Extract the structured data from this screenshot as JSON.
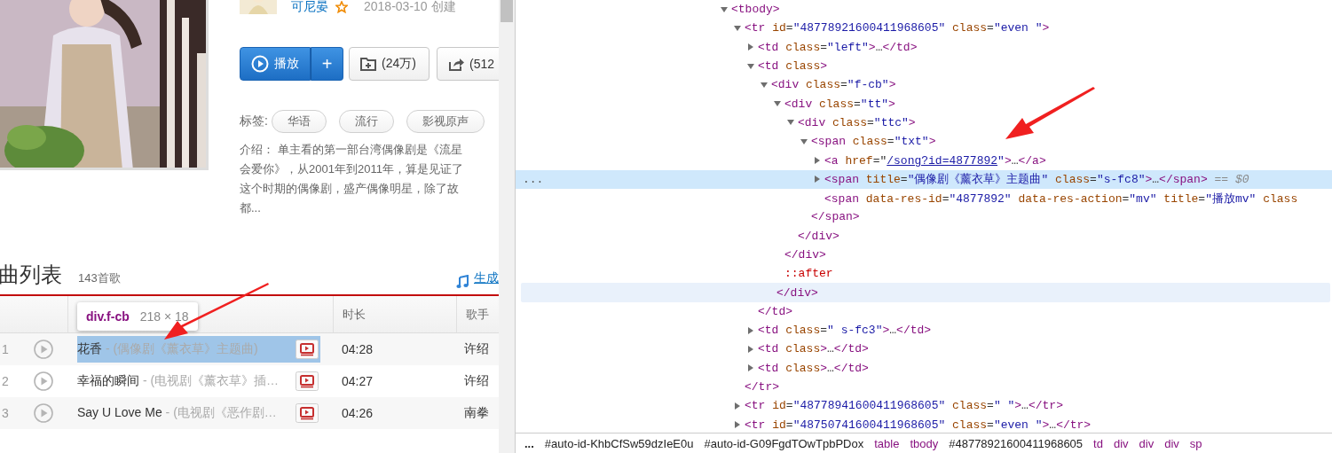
{
  "playlist": {
    "creator": "可尼晏",
    "created": "2018-03-10 创建",
    "buttons": [
      {
        "kind": "play",
        "label": "播放"
      },
      {
        "kind": "add",
        "label": "+"
      },
      {
        "kind": "collect",
        "label": "(24万)"
      },
      {
        "kind": "share",
        "label": "(512"
      }
    ],
    "tags_label": "标签:",
    "tags": [
      "华语",
      "流行",
      "影视原声"
    ],
    "intro_lines": [
      "介绍：  单主看的第一部台湾偶像剧是《流星",
      "会爱你》，从2001年到2011年，算是见证了",
      "这个时期的偶像剧，盛产偶像明星，除了故",
      "都..."
    ]
  },
  "song_list": {
    "title": "曲列表",
    "count": "143首歌",
    "link": "生成",
    "columns": [
      "时长",
      "歌手"
    ],
    "tooltip": {
      "selector": "div.f-cb",
      "size": "218 × 18"
    },
    "rows": [
      {
        "number": "1",
        "title": "花香",
        "subtitle": " - (偶像剧《薰衣草》主题曲)",
        "duration": "04:28",
        "singer": "许绍",
        "highlighted": true
      },
      {
        "number": "2",
        "title": "幸福的瞬间",
        "subtitle": " - (电视剧《薰衣草》插…",
        "duration": "04:27",
        "singer": "许绍",
        "highlighted": false
      },
      {
        "number": "3",
        "title": "Say U Love Me",
        "subtitle": " - (电视剧《恶作剧…",
        "duration": "04:26",
        "singer": "南拳",
        "highlighted": false
      }
    ]
  },
  "devtools": {
    "selection_marker": "...",
    "tree": [
      {
        "expanded": true,
        "selected": false,
        "hovered": false,
        "line": [
          {
            "kind": "tag",
            "text": "<tbody>"
          }
        ],
        "children": [
          {
            "expanded": true,
            "selected": false,
            "hovered": false,
            "line": [
              {
                "kind": "tag",
                "text": "<tr"
              },
              {
                "kind": "attr",
                "text": " id"
              },
              {
                "kind": "text",
                "text": "="
              },
              {
                "kind": "value",
                "text": "\"48778921600411968605\""
              },
              {
                "kind": "attr",
                "text": " class"
              },
              {
                "kind": "text",
                "text": "="
              },
              {
                "kind": "value",
                "text": "\"even \""
              },
              {
                "kind": "tag",
                "text": ">"
              }
            ],
            "close": [
              {
                "kind": "tag",
                "text": "</tr>"
              }
            ],
            "children": [
              {
                "expanded": false,
                "selected": false,
                "hovered": false,
                "line": [
                  {
                    "kind": "tag",
                    "text": "<td"
                  },
                  {
                    "kind": "attr",
                    "text": " class"
                  },
                  {
                    "kind": "text",
                    "text": "="
                  },
                  {
                    "kind": "value",
                    "text": "\"left\""
                  },
                  {
                    "kind": "tag",
                    "text": ">"
                  },
                  {
                    "kind": "text",
                    "text": "…"
                  },
                  {
                    "kind": "tag",
                    "text": "</td>"
                  }
                ]
              },
              {
                "expanded": true,
                "selected": false,
                "hovered": false,
                "line": [
                  {
                    "kind": "tag",
                    "text": "<td"
                  },
                  {
                    "kind": "attr",
                    "text": " class"
                  },
                  {
                    "kind": "tag",
                    "text": ">"
                  }
                ],
                "close": [
                  {
                    "kind": "tag",
                    "text": "</td>"
                  }
                ],
                "children": [
                  {
                    "expanded": true,
                    "selected": false,
                    "hovered": true,
                    "line": [
                      {
                        "kind": "tag",
                        "text": "<div"
                      },
                      {
                        "kind": "attr",
                        "text": " class"
                      },
                      {
                        "kind": "text",
                        "text": "="
                      },
                      {
                        "kind": "value",
                        "text": "\"f-cb\""
                      },
                      {
                        "kind": "tag",
                        "text": ">"
                      }
                    ],
                    "close": [
                      {
                        "kind": "tag",
                        "text": "</div>"
                      }
                    ],
                    "children": [
                      {
                        "expanded": true,
                        "selected": false,
                        "hovered": false,
                        "line": [
                          {
                            "kind": "tag",
                            "text": "<div"
                          },
                          {
                            "kind": "attr",
                            "text": " class"
                          },
                          {
                            "kind": "text",
                            "text": "="
                          },
                          {
                            "kind": "value",
                            "text": "\"tt\""
                          },
                          {
                            "kind": "tag",
                            "text": ">"
                          }
                        ],
                        "close": [
                          {
                            "kind": "tag",
                            "text": "</div>"
                          }
                        ],
                        "children": [
                          {
                            "expanded": true,
                            "selected": false,
                            "hovered": false,
                            "line": [
                              {
                                "kind": "tag",
                                "text": "<div"
                              },
                              {
                                "kind": "attr",
                                "text": " class"
                              },
                              {
                                "kind": "text",
                                "text": "="
                              },
                              {
                                "kind": "value",
                                "text": "\"ttc\""
                              },
                              {
                                "kind": "tag",
                                "text": ">"
                              }
                            ],
                            "close": [
                              {
                                "kind": "tag",
                                "text": "</div>"
                              }
                            ],
                            "children": [
                              {
                                "expanded": true,
                                "selected": false,
                                "hovered": false,
                                "line": [
                                  {
                                    "kind": "tag",
                                    "text": "<span"
                                  },
                                  {
                                    "kind": "attr",
                                    "text": " class"
                                  },
                                  {
                                    "kind": "text",
                                    "text": "="
                                  },
                                  {
                                    "kind": "value",
                                    "text": "\"txt\""
                                  },
                                  {
                                    "kind": "tag",
                                    "text": ">"
                                  }
                                ],
                                "close": [
                                  {
                                    "kind": "tag",
                                    "text": "</span>"
                                  }
                                ],
                                "children": [
                                  {
                                    "expanded": false,
                                    "selected": false,
                                    "hovered": false,
                                    "line": [
                                      {
                                        "kind": "tag",
                                        "text": "<a"
                                      },
                                      {
                                        "kind": "attr",
                                        "text": " href"
                                      },
                                      {
                                        "kind": "text",
                                        "text": "=\""
                                      },
                                      {
                                        "kind": "link",
                                        "text": "/song?id=4877892"
                                      },
                                      {
                                        "kind": "value",
                                        "text": "\""
                                      },
                                      {
                                        "kind": "tag",
                                        "text": ">"
                                      },
                                      {
                                        "kind": "text",
                                        "text": "…"
                                      },
                                      {
                                        "kind": "tag",
                                        "text": "</a>"
                                      }
                                    ]
                                  },
                                  {
                                    "expanded": false,
                                    "selected": true,
                                    "hovered": false,
                                    "line": [
                                      {
                                        "kind": "tag",
                                        "text": "<span"
                                      },
                                      {
                                        "kind": "attr",
                                        "text": " title"
                                      },
                                      {
                                        "kind": "text",
                                        "text": "="
                                      },
                                      {
                                        "kind": "value",
                                        "text": "\"偶像剧《薰衣草》主题曲\""
                                      },
                                      {
                                        "kind": "attr",
                                        "text": " class"
                                      },
                                      {
                                        "kind": "text",
                                        "text": "="
                                      },
                                      {
                                        "kind": "value",
                                        "text": "\"s-fc8\""
                                      },
                                      {
                                        "kind": "tag",
                                        "text": ">"
                                      },
                                      {
                                        "kind": "text",
                                        "text": "…"
                                      },
                                      {
                                        "kind": "tag",
                                        "text": "</span>"
                                      },
                                      {
                                        "kind": "note",
                                        "text": " == $0"
                                      }
                                    ]
                                  },
                                  {
                                    "selected": false,
                                    "hovered": false,
                                    "line": [
                                      {
                                        "kind": "tag",
                                        "text": "<span"
                                      },
                                      {
                                        "kind": "attr",
                                        "text": " data-res-id"
                                      },
                                      {
                                        "kind": "text",
                                        "text": "="
                                      },
                                      {
                                        "kind": "value",
                                        "text": "\"4877892\""
                                      },
                                      {
                                        "kind": "attr",
                                        "text": " data-res-action"
                                      },
                                      {
                                        "kind": "text",
                                        "text": "="
                                      },
                                      {
                                        "kind": "value",
                                        "text": "\"mv\""
                                      },
                                      {
                                        "kind": "attr",
                                        "text": " title"
                                      },
                                      {
                                        "kind": "text",
                                        "text": "="
                                      },
                                      {
                                        "kind": "value",
                                        "text": "\"播放mv\""
                                      },
                                      {
                                        "kind": "attr",
                                        "text": " class"
                                      }
                                    ]
                                  }
                                ]
                              }
                            ]
                          }
                        ]
                      },
                      {
                        "selected": false,
                        "hovered": false,
                        "line": [
                          {
                            "kind": "pseudo",
                            "text": "::after"
                          }
                        ]
                      }
                    ]
                  }
                ]
              },
              {
                "expanded": false,
                "selected": false,
                "hovered": false,
                "line": [
                  {
                    "kind": "tag",
                    "text": "<td"
                  },
                  {
                    "kind": "attr",
                    "text": " class"
                  },
                  {
                    "kind": "text",
                    "text": "="
                  },
                  {
                    "kind": "value",
                    "text": "\" s-fc3\""
                  },
                  {
                    "kind": "tag",
                    "text": ">"
                  },
                  {
                    "kind": "text",
                    "text": "…"
                  },
                  {
                    "kind": "tag",
                    "text": "</td>"
                  }
                ]
              },
              {
                "expanded": false,
                "selected": false,
                "hovered": false,
                "line": [
                  {
                    "kind": "tag",
                    "text": "<td"
                  },
                  {
                    "kind": "attr",
                    "text": " class"
                  },
                  {
                    "kind": "tag",
                    "text": ">"
                  },
                  {
                    "kind": "text",
                    "text": "…"
                  },
                  {
                    "kind": "tag",
                    "text": "</td>"
                  }
                ]
              },
              {
                "expanded": false,
                "selected": false,
                "hovered": false,
                "line": [
                  {
                    "kind": "tag",
                    "text": "<td"
                  },
                  {
                    "kind": "attr",
                    "text": " class"
                  },
                  {
                    "kind": "tag",
                    "text": ">"
                  },
                  {
                    "kind": "text",
                    "text": "…"
                  },
                  {
                    "kind": "tag",
                    "text": "</td>"
                  }
                ]
              }
            ]
          },
          {
            "expanded": false,
            "selected": false,
            "hovered": false,
            "line": [
              {
                "kind": "tag",
                "text": "<tr"
              },
              {
                "kind": "attr",
                "text": " id"
              },
              {
                "kind": "text",
                "text": "="
              },
              {
                "kind": "value",
                "text": "\"48778941600411968605\""
              },
              {
                "kind": "attr",
                "text": " class"
              },
              {
                "kind": "text",
                "text": "="
              },
              {
                "kind": "value",
                "text": "\" \""
              },
              {
                "kind": "tag",
                "text": ">"
              },
              {
                "kind": "text",
                "text": "…"
              },
              {
                "kind": "tag",
                "text": "</tr>"
              }
            ]
          },
          {
            "expanded": false,
            "selected": false,
            "hovered": false,
            "line": [
              {
                "kind": "tag",
                "text": "<tr"
              },
              {
                "kind": "attr",
                "text": " id"
              },
              {
                "kind": "text",
                "text": "="
              },
              {
                "kind": "value",
                "text": "\"48750741600411968605\""
              },
              {
                "kind": "attr",
                "text": " class"
              },
              {
                "kind": "text",
                "text": "="
              },
              {
                "kind": "value",
                "text": "\"even \""
              },
              {
                "kind": "tag",
                "text": ">"
              },
              {
                "kind": "text",
                "text": "…"
              },
              {
                "kind": "tag",
                "text": "</tr>"
              }
            ]
          }
        ]
      }
    ],
    "breadcrumbs": [
      {
        "kind": "more",
        "text": "..."
      },
      {
        "kind": "id",
        "text": "#auto-id-KhbCfSw59dzIeE0u"
      },
      {
        "kind": "id",
        "text": "#auto-id-G09FgdTOwTpbPDox"
      },
      {
        "kind": "tag",
        "text": "table"
      },
      {
        "kind": "tag",
        "text": "tbody"
      },
      {
        "kind": "id",
        "text": "#48778921600411968605"
      },
      {
        "kind": "tag",
        "text": "td"
      },
      {
        "kind": "tag",
        "text": "div"
      },
      {
        "kind": "tag",
        "text": "div"
      },
      {
        "kind": "tag",
        "text": "div"
      },
      {
        "kind": "tag",
        "text": "sp"
      }
    ]
  }
}
